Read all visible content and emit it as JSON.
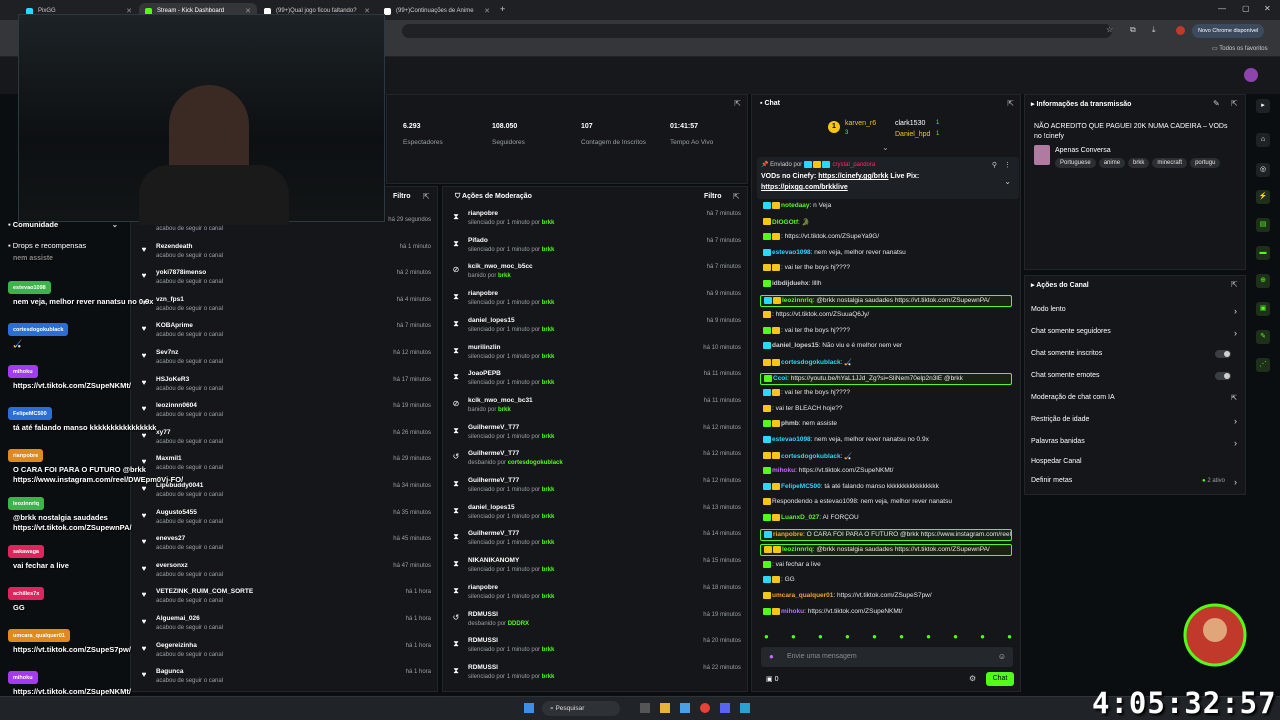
{
  "browser": {
    "tabs": [
      {
        "label": "PixGG",
        "active": false
      },
      {
        "label": "Stream - Kick Dashboard",
        "active": true
      },
      {
        "label": "(99+)Qual jogo ficou faltando?",
        "active": false
      },
      {
        "label": "(99+)Continuações de Anime",
        "active": false
      }
    ],
    "update_button": "Novo Chrome disponível",
    "bookmarks_label": "Todos os favoritos"
  },
  "stats": [
    {
      "value": "6.293",
      "label": "Espectadores"
    },
    {
      "value": "108.050",
      "label": "Seguidores"
    },
    {
      "value": "107",
      "label": "Contagem de Inscritos"
    },
    {
      "value": "01:41:57",
      "label": "Tempo Ao Vivo"
    }
  ],
  "left_menu": {
    "community": "Comunidade",
    "drops": "Drops e recompensas"
  },
  "followers_panel": {
    "filter_label": "Filtro",
    "rows": [
      {
        "name": "",
        "sub": "acabou de seguir o canal",
        "time": "há 29 segundos"
      },
      {
        "name": "Rezendeath",
        "sub": "acabou de seguir o canal",
        "time": "há 1 minuto"
      },
      {
        "name": "yoki7878imenso",
        "sub": "acabou de seguir o canal",
        "time": "há 2 minutos"
      },
      {
        "name": "vzn_fps1",
        "sub": "acabou de seguir o canal",
        "time": "há 4 minutos"
      },
      {
        "name": "KOBAprime",
        "sub": "acabou de seguir o canal",
        "time": "há 7 minutos"
      },
      {
        "name": "Sev7nz",
        "sub": "acabou de seguir o canal",
        "time": "há 12 minutos"
      },
      {
        "name": "HSJoKeR3",
        "sub": "acabou de seguir o canal",
        "time": "há 17 minutos"
      },
      {
        "name": "leozinnn0604",
        "sub": "acabou de seguir o canal",
        "time": "há 19 minutos"
      },
      {
        "name": "xy77",
        "sub": "acabou de seguir o canal",
        "time": "há 26 minutos"
      },
      {
        "name": "Maxmil1",
        "sub": "acabou de seguir o canal",
        "time": "há 29 minutos"
      },
      {
        "name": "Lipebuddy0041",
        "sub": "acabou de seguir o canal",
        "time": "há 34 minutos"
      },
      {
        "name": "Augusto5455",
        "sub": "acabou de seguir o canal",
        "time": "há 35 minutos"
      },
      {
        "name": "eneves27",
        "sub": "acabou de seguir o canal",
        "time": "há 45 minutos"
      },
      {
        "name": "eversonxz",
        "sub": "acabou de seguir o canal",
        "time": "há 47 minutos"
      },
      {
        "name": "VETEZINK_RUIM_COM_SORTE",
        "sub": "acabou de seguir o canal",
        "time": "há 1 hora"
      },
      {
        "name": "Alguemai_026",
        "sub": "acabou de seguir o canal",
        "time": "há 1 hora"
      },
      {
        "name": "Gegereizinha",
        "sub": "acabou de seguir o canal",
        "time": "há 1 hora"
      },
      {
        "name": "Bagunca",
        "sub": "acabou de seguir o canal",
        "time": "há 1 hora"
      }
    ]
  },
  "moderation_panel": {
    "title": "Ações de Moderação",
    "filter_label": "Filtro",
    "rows": [
      {
        "icon": "⧗",
        "name": "rianpobre",
        "action": "silenciado por 1 minuto por",
        "mod": "brkk",
        "time": "há 7 minutos"
      },
      {
        "icon": "⧗",
        "name": "Pifado",
        "action": "silenciado por 1 minuto por",
        "mod": "brkk",
        "time": "há 7 minutos"
      },
      {
        "icon": "⊘",
        "name": "kcik_nwo_moc_b5cc",
        "action": "banido por",
        "mod": "brkk",
        "time": "há 7 minutos"
      },
      {
        "icon": "⧗",
        "name": "rianpobre",
        "action": "silenciado por 1 minuto por",
        "mod": "brkk",
        "time": "há 9 minutos"
      },
      {
        "icon": "⧗",
        "name": "daniel_lopes15",
        "action": "silenciado por 1 minuto por",
        "mod": "brkk",
        "time": "há 9 minutos"
      },
      {
        "icon": "⧗",
        "name": "murilinzlin",
        "action": "silenciado por 1 minuto por",
        "mod": "brkk",
        "time": "há 10 minutos"
      },
      {
        "icon": "⧗",
        "name": "JoaoPEPB",
        "action": "silenciado por 1 minuto por",
        "mod": "brkk",
        "time": "há 11 minutos"
      },
      {
        "icon": "⊘",
        "name": "kcik_nwo_moc_bc31",
        "action": "banido por",
        "mod": "brkk",
        "time": "há 11 minutos"
      },
      {
        "icon": "⧗",
        "name": "GuilhermeV_T77",
        "action": "silenciado por 1 minuto por",
        "mod": "brkk",
        "time": "há 12 minutos"
      },
      {
        "icon": "↺",
        "name": "GuilhermeV_T77",
        "action": "desbanido por",
        "mod": "cortesdogokublack",
        "time": "há 12 minutos"
      },
      {
        "icon": "⧗",
        "name": "GuilhermeV_T77",
        "action": "silenciado por 1 minuto por",
        "mod": "brkk",
        "time": "há 12 minutos"
      },
      {
        "icon": "⧗",
        "name": "daniel_lopes15",
        "action": "silenciado por 1 minuto por",
        "mod": "brkk",
        "time": "há 13 minutos"
      },
      {
        "icon": "⧗",
        "name": "GuilhermeV_T77",
        "action": "silenciado por 1 minuto por",
        "mod": "brkk",
        "time": "há 14 minutos"
      },
      {
        "icon": "⧗",
        "name": "NIKANIKANOMY",
        "action": "silenciado por 1 minuto por",
        "mod": "brkk",
        "time": "há 15 minutos"
      },
      {
        "icon": "⧗",
        "name": "rianpobre",
        "action": "silenciado por 1 minuto por",
        "mod": "brkk",
        "time": "há 18 minutos"
      },
      {
        "icon": "↺",
        "name": "RDMUSSI",
        "action": "desbanido por",
        "mod": "DDDRX",
        "time": "há 19 minutos"
      },
      {
        "icon": "⧗",
        "name": "RDMUSSI",
        "action": "silenciado por 1 minuto por",
        "mod": "brkk",
        "time": "há 20 minutos"
      },
      {
        "icon": "⧗",
        "name": "RDMUSSI",
        "action": "silenciado por 1 minuto por",
        "mod": "brkk",
        "time": "há 22 minutos"
      }
    ]
  },
  "chat": {
    "title": "Chat",
    "top_gifters": [
      {
        "name": "karven_r6",
        "count": "3"
      },
      {
        "name": "clark1530",
        "count": "1"
      },
      {
        "name": "Daniel_hpd",
        "count": "1"
      }
    ],
    "pinned": {
      "prefix": "Enviado por",
      "author": "crystal_pandora",
      "text1": "VODs no Cinefy:",
      "link1": "https://cinefy.gg/brkk",
      "text2": "Live Pix:",
      "link2": "https://pixgg.com/brkklive"
    },
    "messages": [
      {
        "user": "notedaay",
        "color": "#53fc18",
        "text": ": n Veja",
        "hl": false
      },
      {
        "user": "DIOGOtf",
        "color": "#53fc18",
        "text": ": 🐊",
        "hl": false
      },
      {
        "user": "",
        "color": "#ff2b6a",
        "text": ": https://vt.tiktok.com/ZSupeYa9G/",
        "hl": false
      },
      {
        "user": "estevao1098",
        "color": "#2bd9ff",
        "text": ": nem veja, melhor rever nanatsu",
        "hl": false
      },
      {
        "user": "",
        "color": "#ff2b6a",
        "text": ": vai ter the boys hj????",
        "hl": false
      },
      {
        "user": "idbdijduehx",
        "color": "#cfcfcf",
        "text": ": llllh",
        "hl": false
      },
      {
        "user": "leozinnrlq",
        "color": "#53fc18",
        "text": ": @brkk nostalgia saudades https://vt.tiktok.com/ZSupewnPA/",
        "hl": true
      },
      {
        "user": "",
        "color": "#c06bff",
        "text": ": https://vt.tiktok.com/ZSuuaQ6Jy/",
        "hl": false
      },
      {
        "user": "",
        "color": "#ff2b6a",
        "text": ": vai ter the boys hj????",
        "hl": false
      },
      {
        "user": "daniel_lopes15",
        "color": "#cfcfcf",
        "text": ": Não viu e é melhor nem ver",
        "hl": false
      },
      {
        "user": "cortesdogokublack",
        "color": "#2bd9ff",
        "text": ": 🏑",
        "hl": false
      },
      {
        "user": "Ccoi",
        "color": "#2bd9ff",
        "text": ": https://youtu.be/hYaL1JJd_Zg?si=SliNem70elp2n3lE @brkk",
        "hl": true
      },
      {
        "user": "",
        "color": "#ff2b6a",
        "text": ": vai ter the boys hj????",
        "hl": false
      },
      {
        "user": "",
        "color": "#ff2b6a",
        "text": ": vai ter BLEACH hoje??",
        "hl": false
      },
      {
        "user": "phmb",
        "color": "#cfcfcf",
        "text": ": nem assiste",
        "hl": false
      },
      {
        "user": "estevao1098",
        "color": "#2bd9ff",
        "text": ": nem veja, melhor rever nanatsu no 0.9x",
        "hl": false
      },
      {
        "user": "cortesdogokublack",
        "color": "#2bd9ff",
        "text": ": 🏑",
        "hl": false
      },
      {
        "user": "mihoku",
        "color": "#c06bff",
        "text": ": https://vt.tiktok.com/ZSupeNKMt/",
        "hl": false
      },
      {
        "user": "FelipeMC500",
        "color": "#2bd9ff",
        "text": ": tá até falando manso kkkkkkkkkkkkkkkk",
        "hl": false
      },
      {
        "user": "",
        "color": "#8a8f96",
        "text": "Respondendo a estevao1098: nem veja, melhor rever nanatsu",
        "hl": false
      },
      {
        "user": "LuanxD_027",
        "color": "#53fc18",
        "text": ": AI FORÇOU",
        "hl": false
      },
      {
        "user": "rianpobre",
        "color": "#f5a623",
        "text": ": O CARA FOI PARA O FUTURO @brkk https://www.instagram.com/reel/DWEpm0Vj-FO/",
        "hl": true
      },
      {
        "user": "leozinnrlq",
        "color": "#53fc18",
        "text": ": @brkk nostalgia saudades https://vt.tiktok.com/ZSupewnPA/",
        "hl": true
      },
      {
        "user": "",
        "color": "#ff2b6a",
        "text": ": vai fechar a live",
        "hl": false
      },
      {
        "user": "",
        "color": "#ff2b6a",
        "text": ": GG",
        "hl": false
      },
      {
        "user": "umcara_qualquer01",
        "color": "#f5a623",
        "text": ": https://vt.tiktok.com/ZSupeS7pw/",
        "hl": false
      },
      {
        "user": "mihoku",
        "color": "#c06bff",
        "text": ": https://vt.tiktok.com/ZSupeNKMt/",
        "hl": false
      }
    ],
    "input_placeholder": "Envie uma mensagem",
    "count": "0",
    "send_label": "Chat"
  },
  "stream_info": {
    "title": "Informações da transmissão",
    "stream_title": "NÃO ACREDITO QUE PAGUEI 20K NUMA CADEIRA – VODs no !cinefy",
    "category": "Apenas Conversa",
    "tags": [
      "Portuguese",
      "anime",
      "brkk",
      "minecraft",
      "portugu"
    ]
  },
  "channel_actions": {
    "title": "Ações do Canal",
    "items": [
      {
        "label": "Modo lento",
        "control": "chevron"
      },
      {
        "label": "Chat somente seguidores",
        "control": "chevron"
      },
      {
        "label": "Chat somente inscritos",
        "control": "toggle"
      },
      {
        "label": "Chat somente emotes",
        "control": "toggle"
      },
      {
        "label": "Moderação de chat com IA",
        "control": "external"
      },
      {
        "label": "Restrição de idade",
        "control": "chevron"
      },
      {
        "label": "Palavras banidas",
        "control": "chevron"
      },
      {
        "label": "Hospedar Canal",
        "control": "none"
      },
      {
        "label": "Definir metas",
        "control": "chevron",
        "extra": "2 ativo"
      }
    ]
  },
  "overlay_chat": [
    {
      "name": "nem assiste",
      "name_color": "",
      "msg": ""
    },
    {
      "name": "estevao1098",
      "name_color": "#3bb54a",
      "msg": "nem veja, melhor rever nanatsu no 0.9x"
    },
    {
      "name": "cortesdogokublack",
      "name_color": "#2a6fd6",
      "msg": "🏑"
    },
    {
      "name": "mihoku",
      "name_color": "#a33cf0",
      "msg": "https://vt.tiktok.com/ZSupeNKMt/"
    },
    {
      "name": "FelipeMC500",
      "name_color": "#2a6fd6",
      "msg": "tá até falando manso kkkkkkkkkkkkkkkk"
    },
    {
      "name": "rianpobre",
      "name_color": "#e08a1e",
      "msg": "O CARA FOI PARA O FUTURO @brkk https://www.instagram.com/reel/DWEpm0Vj-FO/"
    },
    {
      "name": "leozinnrlq",
      "name_color": "#3bb54a",
      "msg": "@brkk nostalgia saudades https://vt.tiktok.com/ZSupewnPA/"
    },
    {
      "name": "sakawaga",
      "name_color": "#e0245e",
      "msg": "vai fechar a live"
    },
    {
      "name": "achilles7x",
      "name_color": "#e0245e",
      "msg": "GG"
    },
    {
      "name": "umcara_qualquer01",
      "name_color": "#e08a1e",
      "msg": "https://vt.tiktok.com/ZSupeS7pw/"
    },
    {
      "name": "mihoku",
      "name_color": "#a33cf0",
      "msg": "https://vt.tiktok.com/ZSupeNKMt/"
    }
  ],
  "taskbar": {
    "search_label": "Pesquisar"
  },
  "stream_timer": "4:05:32:57",
  "colors": {
    "accent": "#53fc18",
    "panel": "#141619",
    "bg": "#0b0e11"
  }
}
